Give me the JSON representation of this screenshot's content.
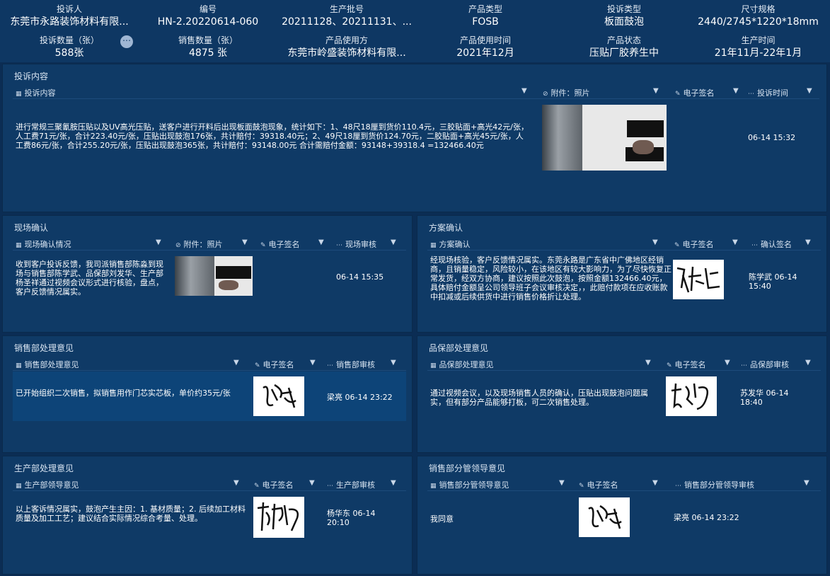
{
  "header": {
    "row1": [
      {
        "key": "投诉人",
        "value": "东莞市永路装饰材料有限..."
      },
      {
        "key": "编号",
        "value": "HN-2.20220614-060"
      },
      {
        "key": "生产批号",
        "value": "20211128、20211131、..."
      },
      {
        "key": "产品类型",
        "value": "FOSB"
      },
      {
        "key": "投诉类型",
        "value": "板面鼓泡"
      },
      {
        "key": "尺寸规格",
        "value": "2440/2745*1220*18mm"
      }
    ],
    "row2": [
      {
        "key": "投诉数量（张）",
        "value": "588张"
      },
      {
        "key": "销售数量（张）",
        "value": "4875 张"
      },
      {
        "key": "产品使用方",
        "value": "东莞市岭盛装饰材料有限..."
      },
      {
        "key": "产品使用时间",
        "value": "2021年12月"
      },
      {
        "key": "产品状态",
        "value": "压贴厂胶养生中"
      },
      {
        "key": "生产时间",
        "value": "21年11月-22年1月"
      }
    ],
    "more_glyph": "⋯"
  },
  "complaint": {
    "title": "投诉内容",
    "cols": [
      "投诉内容",
      "附件：照片",
      "电子签名",
      "投诉时间"
    ],
    "text": "进行常规三聚氰胺压贴以及UV高光压贴，送客户进行开料后出现板面鼓泡现象，统计如下：1、48尺18厘到货价110.4元，三胶贴面+高光42元/张，人工费71元/张，合计223.40元/张，压贴出现鼓泡176张，共计赔付：39318.40元；2、49尺18厘到货价124.70元，二胶贴面+高光45元/张，人工费86元/张，合计255.20元/张，压贴出现鼓泡365张，共计赔付：93148.00元 合计需赔付金额：93148+39318.4 =132466.40元",
    "time": "06-14 15:32"
  },
  "site": {
    "title": "现场确认",
    "cols": [
      "现场确认情况",
      "附件：照片",
      "电子签名",
      "现场审核"
    ],
    "text": "收到客户投诉反馈，我司派销售部陈淼到现场与销售部陈学武、品保部刘发华、生产部杨圣祥通过视频会议形式进行核验，盘点，客户反馈情况属实。",
    "time": "06-14 15:35"
  },
  "plan": {
    "title": "方案确认",
    "cols": [
      "方案确认",
      "电子签名",
      "确认签名"
    ],
    "text": "经现场核验，客户反馈情况属实。东莞永路是广东省中广佛地区经销商，且销量稳定，风险较小，在该地区有较大影响力，为了尽快恢复正常发货，经双方协商，建议按照此次鼓泡，按照金额132466.40元，具体赔付金额呈公司领导班子会议审核决定，，此赔付款项在应收账款中扣减或后续供货中进行销售价格折让处理。",
    "signer": "陈学武 06-14 15:40"
  },
  "sales": {
    "title": "销售部处理意见",
    "cols": [
      "销售部处理意见",
      "电子签名",
      "销售部审核"
    ],
    "text": "已开始组织二次销售，拟销售用作门芯实芯板，单价约35元/张",
    "signer": "梁亮 06-14 23:22"
  },
  "quality": {
    "title": "品保部处理意见",
    "cols": [
      "品保部处理意见",
      "电子签名",
      "品保部审核"
    ],
    "text": "通过视频会议，以及现场销售人员的确认，压贴出现鼓泡问题属实，但有部分产品能够打板，可二次销售处理。",
    "signer": "苏发华 06-14 18:40"
  },
  "production": {
    "title": "生产部处理意见",
    "cols": [
      "生产部领导意见",
      "电子签名",
      "生产部审核"
    ],
    "text": "以上客诉情况属实，鼓泡产生主因：1. 基材质量；2. 后续加工材料质量及加工工艺；建议结合实际情况综合考量、处理。",
    "signer": "杨华东 06-14 20:10"
  },
  "leader": {
    "title": "销售部分管领导意见",
    "cols": [
      "销售部分管领导意见",
      "电子签名",
      "销售部分管领导审核"
    ],
    "text": "我同意",
    "signer": "梁亮 06-14 23:22"
  }
}
